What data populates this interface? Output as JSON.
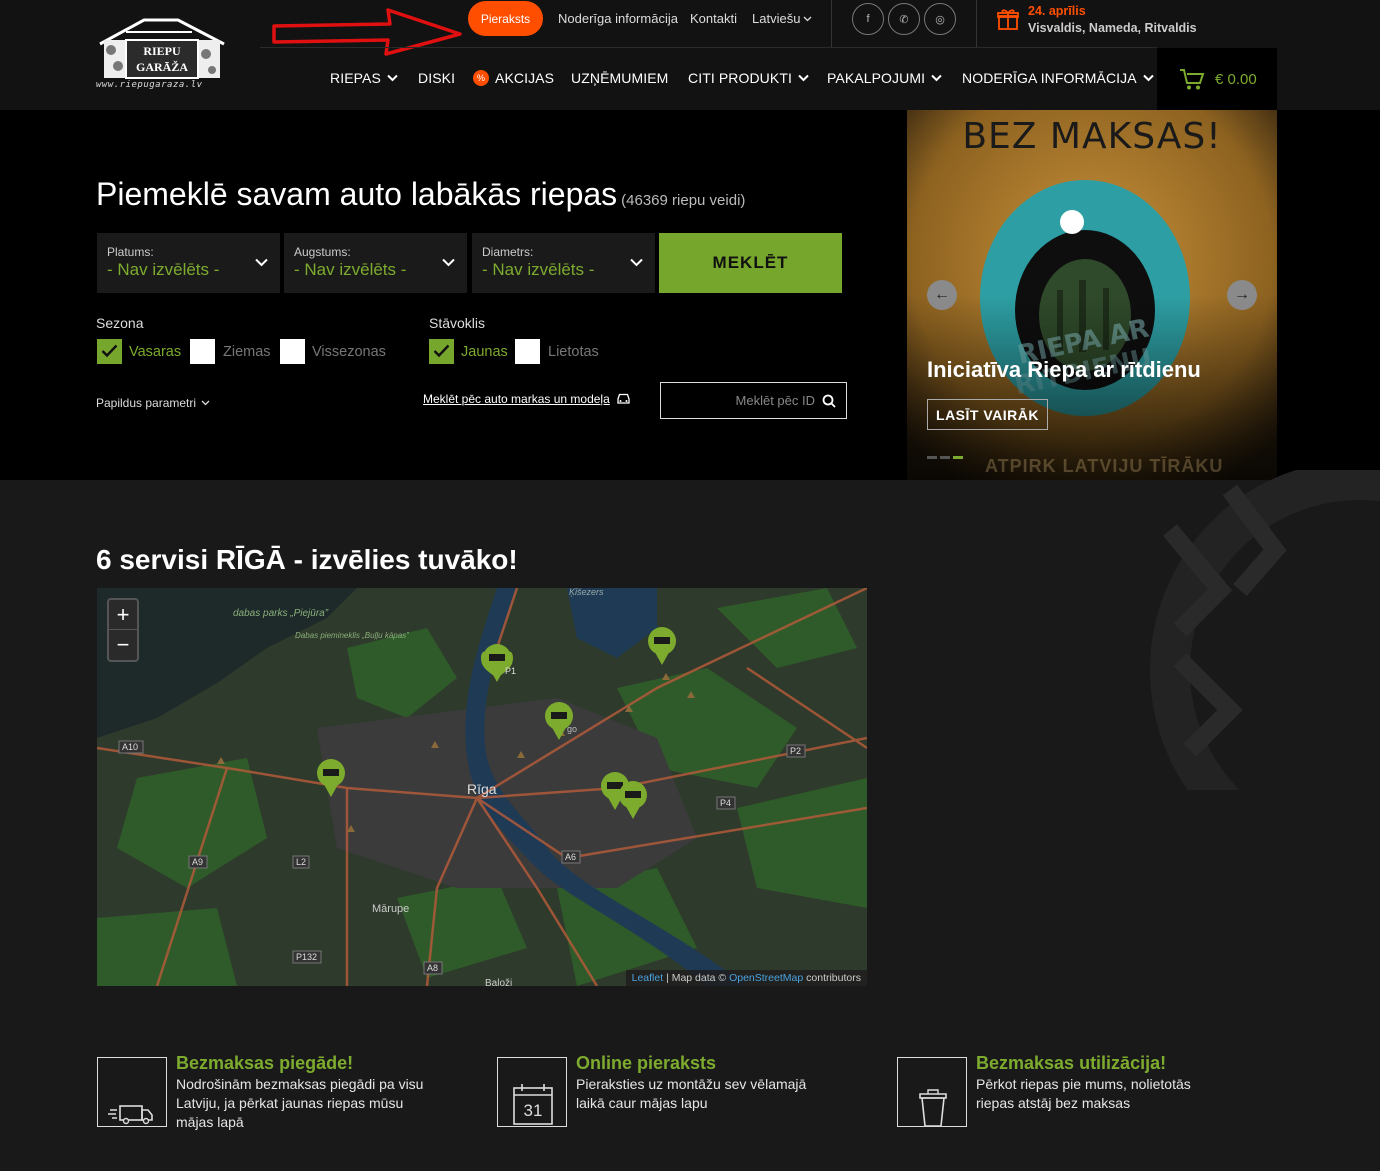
{
  "header": {
    "logo_text": [
      "RIEPU",
      "GARĀŽA"
    ],
    "logo_url_text": "www.riepugaraza.lv",
    "topbar": {
      "appointment_button": "Pieraksts",
      "useful_info": "Noderīga informācija",
      "contacts": "Kontakti",
      "language": "Latviešu"
    },
    "social": [
      {
        "name": "facebook-icon",
        "glyph": "f"
      },
      {
        "name": "whatsapp-icon",
        "glyph": "✆"
      },
      {
        "name": "instagram-icon",
        "glyph": "◎"
      }
    ],
    "nameday": {
      "date": "24. aprīlis",
      "names": "Visvaldis, Nameda, Ritvaldis"
    },
    "nav": [
      {
        "label": "RIEPAS",
        "dropdown": true
      },
      {
        "label": "DISKI",
        "dropdown": false
      },
      {
        "label": "AKCIJAS",
        "dropdown": false,
        "badge": "%"
      },
      {
        "label": "UZŅĒMUMIEM",
        "dropdown": false
      },
      {
        "label": "CITI PRODUKTI",
        "dropdown": true
      },
      {
        "label": "PAKALPOJUMI",
        "dropdown": true
      },
      {
        "label": "NODERĪGA INFORMĀCIJA",
        "dropdown": true
      }
    ],
    "cart_total": "€ 0.00"
  },
  "hero": {
    "title": "Piemeklē savam auto labākās riepas",
    "count": "(46369 riepu veidi)",
    "selects": [
      {
        "label": "Platums:",
        "value": "- Nav izvēlēts -"
      },
      {
        "label": "Augstums:",
        "value": "- Nav izvēlēts -"
      },
      {
        "label": "Diametrs:",
        "value": "- Nav izvēlēts -"
      }
    ],
    "search_button": "MEKLĒT",
    "season": {
      "label": "Sezona",
      "options": [
        {
          "label": "Vasaras",
          "checked": true
        },
        {
          "label": "Ziemas",
          "checked": false
        },
        {
          "label": "Vissezonas",
          "checked": false
        }
      ]
    },
    "condition": {
      "label": "Stāvoklis",
      "options": [
        {
          "label": "Jaunas",
          "checked": true
        },
        {
          "label": "Lietotas",
          "checked": false
        }
      ]
    },
    "extra_params": "Papildus parametri",
    "brand_link": "Meklēt pēc auto markas un modeļa",
    "id_placeholder": "Meklēt pēc ID"
  },
  "carousel": {
    "headline": "BEZ MAKSAS!",
    "title": "Iniciatīva Riepa ar rītdienu",
    "button": "LASĪT VAIRĀK",
    "ghost_text": "ATPIRK LATVIJU TĪRĀKU",
    "dots": 3,
    "active_dot": 2
  },
  "services": {
    "title": "6 servisi RĪGĀ - izvēlies tuvāko!",
    "map": {
      "city_label": "Rīga",
      "place_labels": [
        "Mārupe",
        "Baloži",
        "Ķīšezers",
        "dabas parks „Piejūra”",
        "Dabas piemineklis „Buļļu kāpas”",
        "go"
      ],
      "road_labels": [
        "A10",
        "A9",
        "L2",
        "P132",
        "A8",
        "A6",
        "P4",
        "P2",
        "P1"
      ],
      "markers": 6,
      "zoom_in": "+",
      "zoom_out": "−",
      "attribution": {
        "leaflet": "Leaflet",
        "sep": " | Map data © ",
        "osm": "OpenStreetMap",
        "tail": " contributors"
      }
    }
  },
  "features": [
    {
      "icon": "delivery-truck-icon",
      "title": "Bezmaksas piegāde!",
      "text": "Nodrošinām bezmaksas piegādi pa visu Latviju, ja pērkat jaunas riepas mūsu mājas lapā"
    },
    {
      "icon": "calendar-icon",
      "icon_text": "31",
      "title": "Online pieraksts",
      "text": "Pieraksties uz montāžu sev vēlamajā laikā caur mājas lapu"
    },
    {
      "icon": "trash-bin-icon",
      "title": "Bezmaksas utilizācija!",
      "text": "Pērkot riepas pie mums, nolietotās riepas atstāj bez maksas"
    }
  ],
  "colors": {
    "accent_green": "#76a62b",
    "accent_orange": "#ff4e00",
    "background": "#191919"
  }
}
